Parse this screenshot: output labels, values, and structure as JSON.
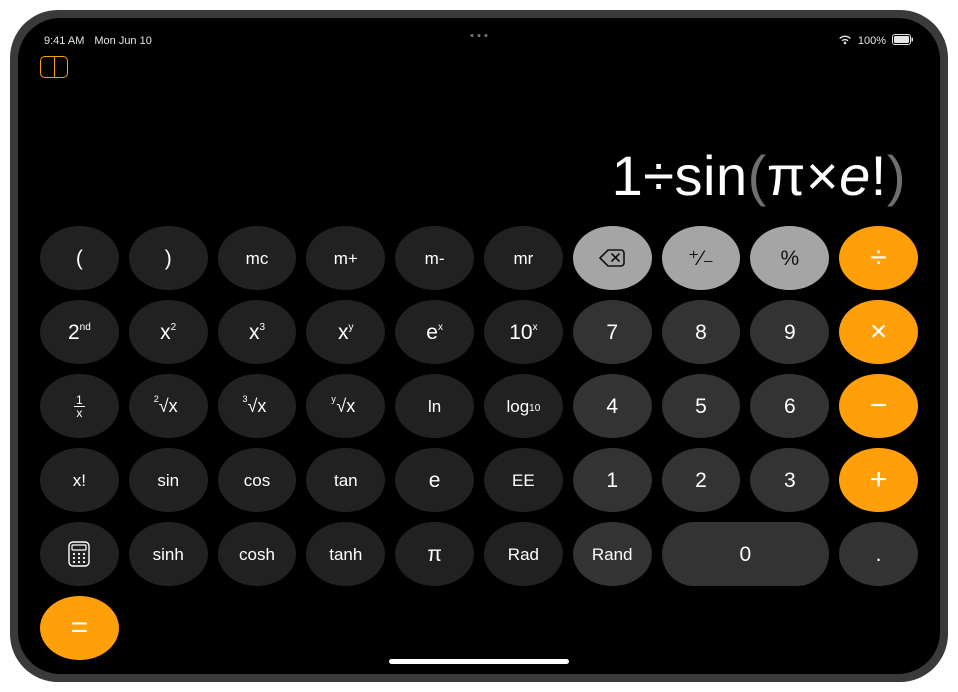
{
  "status": {
    "time": "9:41 AM",
    "date": "Mon Jun 10",
    "battery_pct": "100%"
  },
  "display": {
    "expression_plain": "1÷sin(π×e!)",
    "one": "1",
    "div": "÷",
    "sin": "sin",
    "open": "(",
    "pi": "π",
    "mult": "×",
    "e": "e",
    "fact": "!",
    "close": ")"
  },
  "keys": {
    "open_paren": "(",
    "close_paren": ")",
    "mc": "mc",
    "mplus": "m+",
    "mminus": "m-",
    "mr": "mr",
    "backspace": "⌫",
    "plusminus": "⁺⁄₋",
    "percent": "%",
    "divide": "÷",
    "second": "2",
    "second_sup": "nd",
    "xsq_base": "x",
    "xsq_sup": "2",
    "xcu_base": "x",
    "xcu_sup": "3",
    "xy_base": "x",
    "xy_sup": "y",
    "ex_base": "e",
    "ex_sup": "x",
    "tenx_base": "10",
    "tenx_sup": "x",
    "d7": "7",
    "d8": "8",
    "d9": "9",
    "multiply": "×",
    "recip_num": "1",
    "recip_den": "x",
    "sqrt": "√x",
    "cbrt_deg": "3",
    "cbrt": "√x",
    "yroot_deg": "y",
    "yroot": "√x",
    "ln": "ln",
    "log10_base": "log",
    "log10_sub": "10",
    "d4": "4",
    "d5": "5",
    "d6": "6",
    "minus": "−",
    "xfact": "x!",
    "sin": "sin",
    "cos": "cos",
    "tan": "tan",
    "e": "e",
    "ee": "EE",
    "d1": "1",
    "d2": "2",
    "d3": "3",
    "plus": "+",
    "sinh": "sinh",
    "cosh": "cosh",
    "tanh": "tanh",
    "pi": "π",
    "rad": "Rad",
    "rand": "Rand",
    "d0": "0",
    "dot": ".",
    "equals": "="
  }
}
